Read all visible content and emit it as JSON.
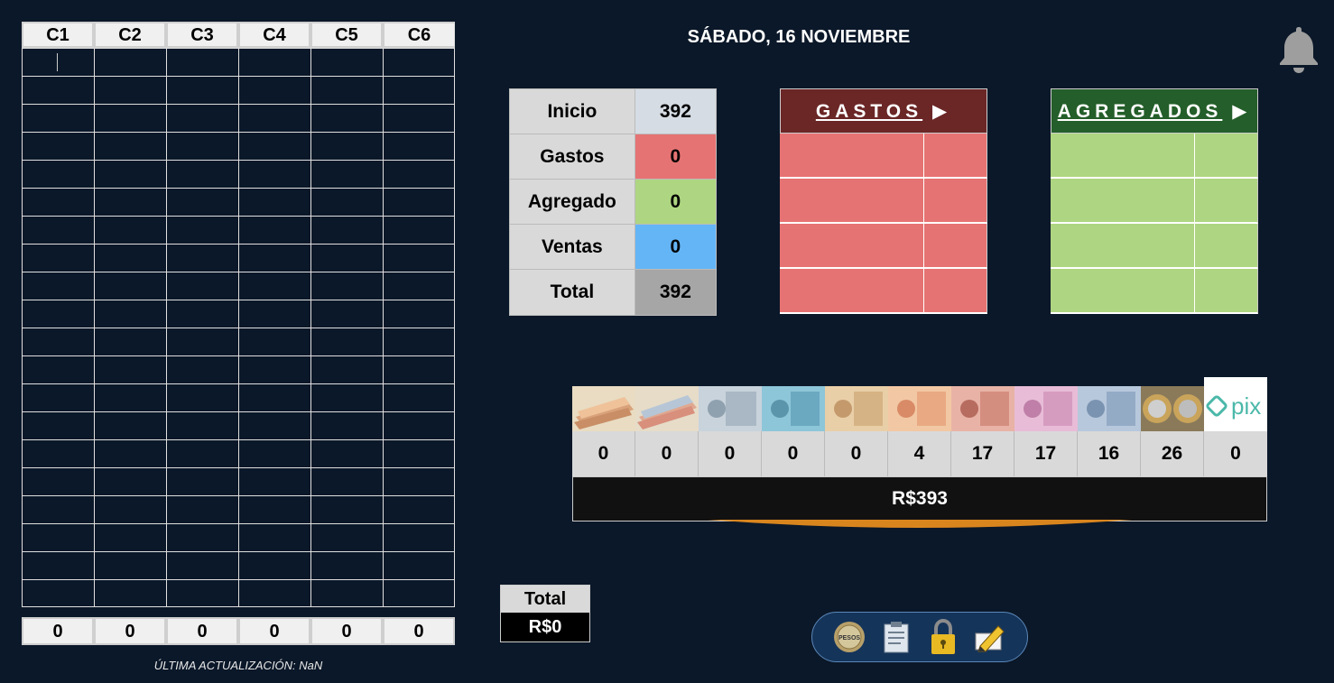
{
  "grid": {
    "headers": [
      "C1",
      "C2",
      "C3",
      "C4",
      "C5",
      "C6"
    ],
    "row_count": 20,
    "totals": [
      "0",
      "0",
      "0",
      "0",
      "0",
      "0"
    ],
    "last_update": "ÚLTIMA ACTUALIZACIÓN: NaN"
  },
  "header": {
    "date": "SÁBADO, 16 NOVIEMBRE"
  },
  "summary": {
    "rows": [
      {
        "label": "Inicio",
        "value": "392",
        "color": "#d6dce4"
      },
      {
        "label": "Gastos",
        "value": "0",
        "color": "#e67373"
      },
      {
        "label": "Agregado",
        "value": "0",
        "color": "#aed581"
      },
      {
        "label": "Ventas",
        "value": "0",
        "color": "#64b5f6"
      },
      {
        "label": "Total",
        "value": "392",
        "color": "#a6a6a6"
      }
    ]
  },
  "gastos": {
    "title": "GASTOS",
    "arrow": "▶",
    "color": "#6b2626",
    "fill": "#e67373"
  },
  "agregados": {
    "title": "AGREGADOS",
    "arrow": "▶",
    "color": "#245e2a",
    "fill": "#aed581"
  },
  "currency": {
    "items": [
      {
        "icon": "bundle-20-icon",
        "count": "0"
      },
      {
        "icon": "bundle-mixed-icon",
        "count": "0"
      },
      {
        "icon": "note-200-icon",
        "count": "0"
      },
      {
        "icon": "note-100-icon",
        "count": "0"
      },
      {
        "icon": "note-50-icon",
        "count": "0"
      },
      {
        "icon": "note-20-icon",
        "count": "4"
      },
      {
        "icon": "note-10-icon",
        "count": "17"
      },
      {
        "icon": "note-5-icon",
        "count": "17"
      },
      {
        "icon": "note-2-icon",
        "count": "16"
      },
      {
        "icon": "coin-1-icon",
        "count": "26"
      },
      {
        "icon": "pix-icon",
        "count": "0"
      }
    ],
    "total": "R$393",
    "pix_label": "pix"
  },
  "bottom_total": {
    "label": "Total",
    "value": "R$0"
  },
  "toolbar": {
    "items": [
      "pesos-coin-icon",
      "clipboard-icon",
      "lock-icon",
      "edit-icon"
    ],
    "coin_text": "PESOS"
  }
}
